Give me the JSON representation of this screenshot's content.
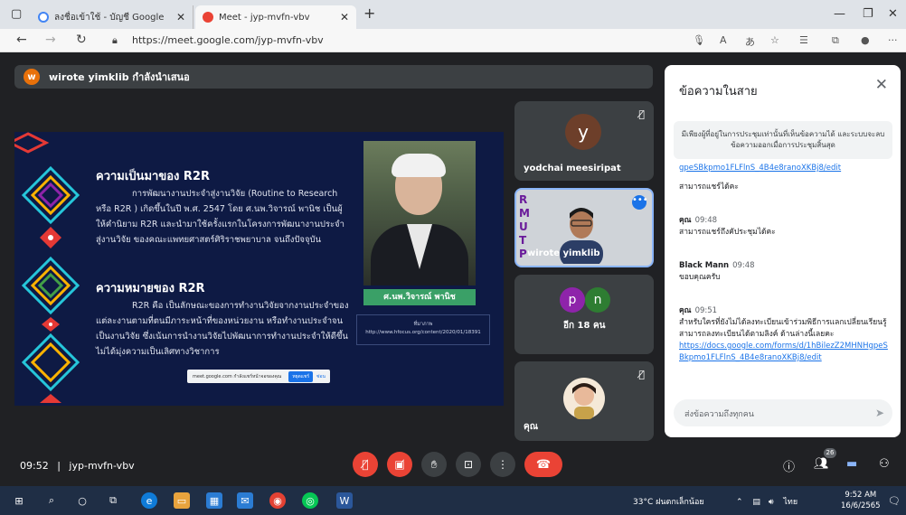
{
  "browser": {
    "tabs": [
      {
        "label": "ลงชื่อเข้าใช้ - บัญชี Google",
        "favicon_color": "#4285f4"
      },
      {
        "label": "Meet - jyp-mvfn-vbv",
        "favicon_color": "#ea4335"
      }
    ],
    "url": "https://meet.google.com/jyp-mvfn-vbv"
  },
  "presenter": {
    "avatar_letter": "w",
    "text": "wirote yimklib กำลังนำเสนอ"
  },
  "slide": {
    "title1": "ความเป็นมาของ R2R",
    "body1": "การพัฒนางานประจำสู่งานวิจัย (Routine to Research หรือ R2R ) เกิดขึ้นในปี พ.ศ. 2547 โดย ศ.นพ.วิจารณ์ พานิช เป็นผู้ให้คำนิยาม R2R และนำมาใช้ครั้งแรกในโครงการพัฒนางานประจำสู่งานวิจัย ของคณะแพทยศาสตร์ศิริราชพยาบาล จนถึงปัจจุบัน",
    "title2": "ความหมายของ R2R",
    "body2": "R2R คือ เป็นลักษณะของการทำงานวิจัยจากงานประจำของแต่ละงานตามที่ตนมีภาระหน้าที่ของหน่วยงาน หรือทำงานประจำจนเป็นงานวิจัย ซึ่งเน้นการนำงานวิจัยไปพัฒนาการทำงานประจำให้ดีขึ้น ไม่ได้มุ่งความเป็นเลิศทางวิชาการ",
    "photo_caption": "ศ.นพ.วิจารณ์ พานิช",
    "ref_label": "ที่มาภาพ",
    "ref_url": "http://www.hfocus.org/content/2020/01/18391",
    "share_text": "meet.google.com กำลังแชร์หน้าจอของคุณ",
    "share_stop": "หยุดแชร์",
    "share_hide": "ซ่อน"
  },
  "tiles": {
    "tile1": {
      "letter": "y",
      "name": "yodchai meesiripat",
      "avatar_color": "#6d3f2a"
    },
    "tile2": {
      "name": "wirote yimklib",
      "logo": "RMUTP"
    },
    "tile3": {
      "letters": [
        "p",
        "n"
      ],
      "name": "อีก 18 คน",
      "colors": [
        "#8e24aa",
        "#2e7d32"
      ]
    },
    "tile4": {
      "name": "คุณ"
    }
  },
  "chat": {
    "title": "ข้อความในสาย",
    "notice": "มีเพียงผู้ที่อยู่ในการประชุมเท่านั้นที่เห็นข้อความได้ และระบบจะลบข้อความออกเมื่อการประชุมสิ้นสุด",
    "messages": [
      {
        "who": "",
        "time": "",
        "link": "gpeSBkpmo1FLFlnS_4B4e8ranoXKBj8/edit",
        "text": "สามารถแชร์ได้คะ"
      },
      {
        "who": "คุณ",
        "time": "09:48",
        "text": "สามารถแชร์ถึงคัประชุมได้คะ"
      },
      {
        "who": "Black Mann",
        "time": "09:48",
        "text": "ขอบคุณครับ"
      },
      {
        "who": "คุณ",
        "time": "09:51",
        "text": "สำหรับใครที่ยังไม่ได้ลงทะเบียนเข้าร่วมพิธีการแลกเปลี่ยนเรียนรู้ สามารถลงทะเบียนได้ตามลิงค์ ด้านล่างนี้เลยคะ",
        "link": "https://docs.google.com/forms/d/1hBilezZ2MHNHgpeSBkpmo1FLFlnS_4B4e8ranoXKBj8/edit"
      }
    ],
    "input_placeholder": "ส่งข้อความถึงทุกคน"
  },
  "bottom": {
    "time": "09:52",
    "code": "jyp-mvfn-vbv",
    "participants_badge": "26"
  },
  "taskbar": {
    "weather": "33°C ฝนตกเล็กน้อย",
    "lang": "ไทย",
    "time": "9:52 AM",
    "date": "16/6/2565"
  }
}
